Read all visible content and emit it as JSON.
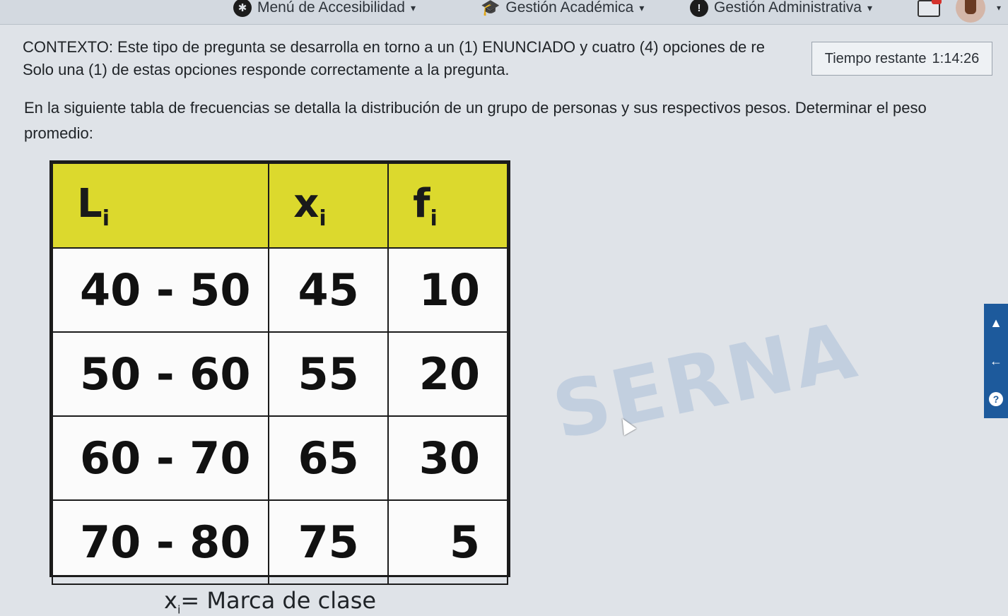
{
  "nav": {
    "accessibility_label": "Menú de Accesibilidad",
    "academic_label": "Gestión Académica",
    "administrative_label": "Gestión Administrativa"
  },
  "icons": {
    "accessibility": "accessibility-icon",
    "academic": "graduation-cap-icon",
    "administrative": "info-icon",
    "mail": "mail-icon",
    "avatar": "user-avatar",
    "scroll_up": "arrow-up-icon",
    "back": "arrow-left-icon",
    "help": "question-icon"
  },
  "timer": {
    "label": "Tiempo restante",
    "value": "1:14:26"
  },
  "context": {
    "line1": "CONTEXTO: Este tipo de pregunta se desarrolla en torno a un (1) ENUNCIADO y cuatro (4) opciones de re",
    "line2": "Solo una (1) de estas opciones responde correctamente a la pregunta."
  },
  "question": {
    "text": "En la siguiente tabla de frecuencias se detalla la distribución de un grupo de personas y sus respectivos pesos. Determinar el peso promedio:"
  },
  "table": {
    "headers": [
      {
        "main": "L",
        "sub": "i"
      },
      {
        "main": "x",
        "sub": "i"
      },
      {
        "main": "f",
        "sub": "i"
      }
    ],
    "rows": [
      {
        "li": "40 - 50",
        "xi": "45",
        "fi": "10"
      },
      {
        "li": "50 - 60",
        "xi": "55",
        "fi": "20"
      },
      {
        "li": "60 - 70",
        "xi": "65",
        "fi": "30"
      },
      {
        "li": "70 - 80",
        "xi": "75",
        "fi": "5"
      }
    ]
  },
  "note": {
    "symbol": "x",
    "sub": "i",
    "text": "= Marca de clase"
  },
  "watermark": "SERNA",
  "colors": {
    "header_bg": "#dcd92d",
    "side_tools": "#1d5a9c"
  }
}
